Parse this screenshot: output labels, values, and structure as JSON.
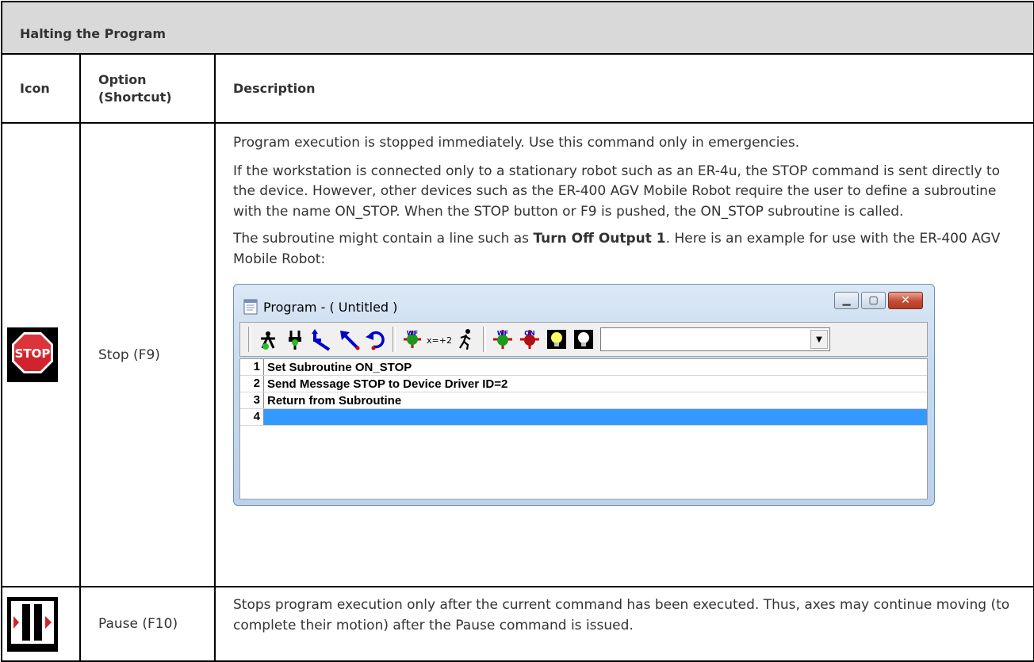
{
  "table": {
    "title": "Halting the Program",
    "headers": {
      "icon": "Icon",
      "option": "Option (Shortcut)",
      "description": "Description"
    },
    "rows": [
      {
        "icon": "stop-sign-icon",
        "option": "Stop (F9)",
        "desc": {
          "p1": "Program execution is stopped immediately. Use this command only in emergencies.",
          "p2": "If the workstation is connected only to a stationary robot such as an ER-4u, the STOP command is sent directly to the device. However, other devices such as the ER-400 AGV Mobile Robot require the user to define a subroutine with the name ON_STOP. When the STOP button or F9 is pushed, the ON_STOP subroutine is called.",
          "p3_before": "The subroutine might contain a line such as ",
          "p3_bold": "Turn Off Output 1",
          "p3_after": ". Here is an example for use with the ER-400 AGV Mobile Robot:"
        }
      },
      {
        "icon": "pause-icon",
        "option": "Pause (F10)",
        "desc": {
          "p1": "Stops program execution only after the current command has been executed. Thus, axes may continue moving (to complete their motion) after the Pause command is issued."
        }
      }
    ]
  },
  "stop_icon_text": "STOP",
  "window": {
    "title": "Program -  ( Untitled )",
    "buttons": {
      "minimize": "▁",
      "maximize": "▢",
      "close": "✕"
    },
    "toolbar_icons": [
      "robot-home-icon",
      "robot-grip-icon",
      "move-arc-blue-icon",
      "move-arrow-blue-icon",
      "undo-rotate-icon",
      "insert-wf-icon",
      "variable-x-icon",
      "running-man-icon",
      "wf-green-icon",
      "on-red-icon",
      "bulb-on-icon",
      "bulb-off-icon"
    ],
    "toolbar_text": {
      "var": "x=+2",
      "wf": "WF",
      "on": "ON"
    },
    "dropdown_value": "",
    "dropdown_arrow": "▼",
    "lines": [
      {
        "num": "1",
        "text": "Set Subroutine ON_STOP"
      },
      {
        "num": "2",
        "text": "Send Message STOP to Device Driver  ID=2"
      },
      {
        "num": "3",
        "text": "Return from Subroutine"
      },
      {
        "num": "4",
        "text": ""
      }
    ]
  }
}
